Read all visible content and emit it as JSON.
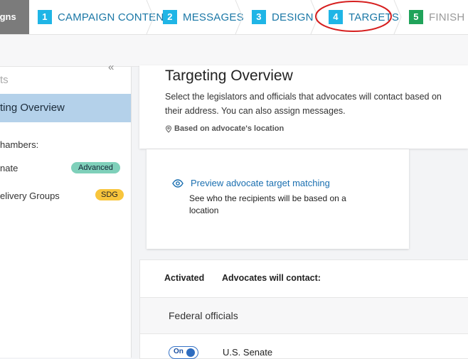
{
  "header": {
    "crumb": "igns",
    "steps": [
      {
        "num": "1",
        "label": "CAMPAIGN CONTENT",
        "color": "#1fb5e6"
      },
      {
        "num": "2",
        "label": "MESSAGES",
        "color": "#1fb5e6"
      },
      {
        "num": "3",
        "label": "DESIGN",
        "color": "#1fb5e6"
      },
      {
        "num": "4",
        "label": "TARGETS",
        "color": "#1fb5e6"
      },
      {
        "num": "5",
        "label": "FINISH",
        "color": "#20a35a"
      }
    ]
  },
  "sidebar": {
    "heading": "ts",
    "collapse": "«",
    "active_item": "ting Overview",
    "subheading": "hambers:",
    "items": [
      {
        "label": "nate",
        "badge": "Advanced"
      },
      {
        "label": "elivery Groups",
        "badge": "SDG"
      }
    ]
  },
  "overview": {
    "title": "Targeting Overview",
    "description": "Select the legislators and officials that advocates will contact based on their address. You can also assign messages.",
    "location": "Based on advocate's location"
  },
  "preview": {
    "link": "Preview advocate target matching",
    "subtext": "See who the recipients will be based on a location"
  },
  "table": {
    "col_activated": "Activated",
    "col_contact": "Advocates will contact:",
    "group": "Federal officials",
    "rows": [
      {
        "toggle": "On",
        "name": "U.S. Senate"
      }
    ]
  }
}
